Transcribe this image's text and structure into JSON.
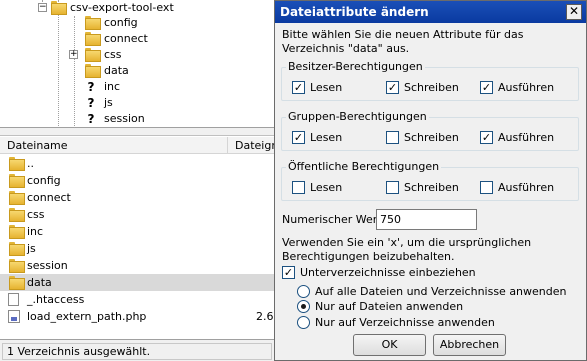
{
  "tree": {
    "root": "csv-export-tool-ext",
    "items": [
      {
        "label": "config",
        "icon": "folder-icon"
      },
      {
        "label": "connect",
        "icon": "folder-icon"
      },
      {
        "label": "css",
        "icon": "folder-icon",
        "expander": "+"
      },
      {
        "label": "data",
        "icon": "folder-icon"
      },
      {
        "label": "inc",
        "icon": "question-folder-icon"
      },
      {
        "label": "js",
        "icon": "question-folder-icon"
      },
      {
        "label": "session",
        "icon": "question-folder-icon"
      }
    ]
  },
  "list": {
    "columns": [
      "Dateiname",
      "Dateigrö"
    ],
    "rows": [
      {
        "name": "..",
        "icon": "parent-folder-icon",
        "size": ""
      },
      {
        "name": "config",
        "icon": "folder-icon",
        "size": ""
      },
      {
        "name": "connect",
        "icon": "folder-icon",
        "size": ""
      },
      {
        "name": "css",
        "icon": "folder-icon",
        "size": ""
      },
      {
        "name": "inc",
        "icon": "folder-icon",
        "size": ""
      },
      {
        "name": "js",
        "icon": "folder-icon",
        "size": ""
      },
      {
        "name": "session",
        "icon": "folder-icon",
        "size": ""
      },
      {
        "name": "data",
        "icon": "folder-icon",
        "size": "",
        "selected": true
      },
      {
        "name": "_.htaccess",
        "icon": "file-icon",
        "size": ""
      },
      {
        "name": "load_extern_path.php",
        "icon": "php-file-icon",
        "size": "2.6"
      }
    ]
  },
  "statusbar": {
    "text": "1 Verzeichnis ausgewählt."
  },
  "dialog": {
    "title": "Dateiattribute ändern",
    "close": "✕",
    "intro": "Bitte wählen Sie die neuen Attribute für das Verzeichnis \"data\" aus.",
    "groups": [
      {
        "title": "Besitzer-Berechtigungen",
        "items": [
          {
            "label": "Lesen",
            "checked": true
          },
          {
            "label": "Schreiben",
            "checked": true
          },
          {
            "label": "Ausführen",
            "checked": true
          }
        ]
      },
      {
        "title": "Gruppen-Berechtigungen",
        "items": [
          {
            "label": "Lesen",
            "checked": true
          },
          {
            "label": "Schreiben",
            "checked": false
          },
          {
            "label": "Ausführen",
            "checked": true
          }
        ]
      },
      {
        "title": "Öffentliche Berechtigungen",
        "items": [
          {
            "label": "Lesen",
            "checked": false
          },
          {
            "label": "Schreiben",
            "checked": false
          },
          {
            "label": "Ausführen",
            "checked": false
          }
        ]
      }
    ],
    "numeric_label": "Numerischer Wert:",
    "numeric_value": "750",
    "hint": "Verwenden Sie ein 'x', um die ursprünglichen Berechtigungen beizubehalten.",
    "recurse": {
      "label": "Unterverzeichnisse einbeziehen",
      "checked": true
    },
    "radios": [
      {
        "label": "Auf alle Dateien und Verzeichnisse anwenden",
        "selected": false
      },
      {
        "label": "Nur auf Dateien anwenden",
        "selected": true
      },
      {
        "label": "Nur auf Verzeichnisse anwenden",
        "selected": false
      }
    ],
    "ok": "OK",
    "cancel": "Abbrechen"
  }
}
